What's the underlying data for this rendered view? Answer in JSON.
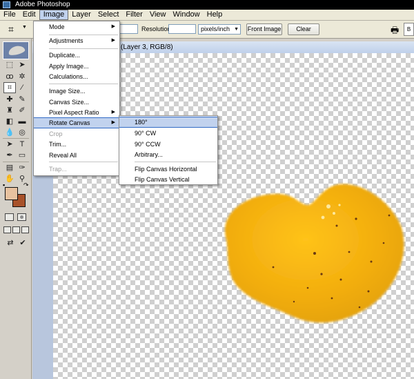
{
  "app": {
    "title": "Adobe Photoshop"
  },
  "menubar": [
    "File",
    "Edit",
    "Image",
    "Layer",
    "Select",
    "Filter",
    "View",
    "Window",
    "Help"
  ],
  "options": {
    "resolution_label": "Resolution:",
    "units": "pixels/inch",
    "front_image": "Front Image",
    "clear": "Clear",
    "b_label": "B"
  },
  "document": {
    "title_visible": "(Layer 3, RGB/8)"
  },
  "image_menu": [
    {
      "label": "Mode"
    },
    {
      "label": "Adjustments"
    },
    {
      "label": "Duplicate..."
    },
    {
      "label": "Apply Image..."
    },
    {
      "label": "Calculations..."
    },
    {
      "label": "Image Size..."
    },
    {
      "label": "Canvas Size..."
    },
    {
      "label": "Pixel Aspect Ratio"
    },
    {
      "label": "Rotate Canvas"
    },
    {
      "label": "Crop"
    },
    {
      "label": "Trim..."
    },
    {
      "label": "Reveal All"
    },
    {
      "label": "Trap..."
    }
  ],
  "rotate_submenu": [
    {
      "label": "180°"
    },
    {
      "label": "90° CW"
    },
    {
      "label": "90° CCW"
    },
    {
      "label": "Arbitrary..."
    },
    {
      "label": "Flip Canvas Horizontal"
    },
    {
      "label": "Flip Canvas Vertical"
    }
  ],
  "colors": {
    "foreground": "#e8c29f",
    "background": "#a8522a",
    "menu_highlight": "#c1d2ee",
    "object_fill": "#f2ad0e"
  }
}
